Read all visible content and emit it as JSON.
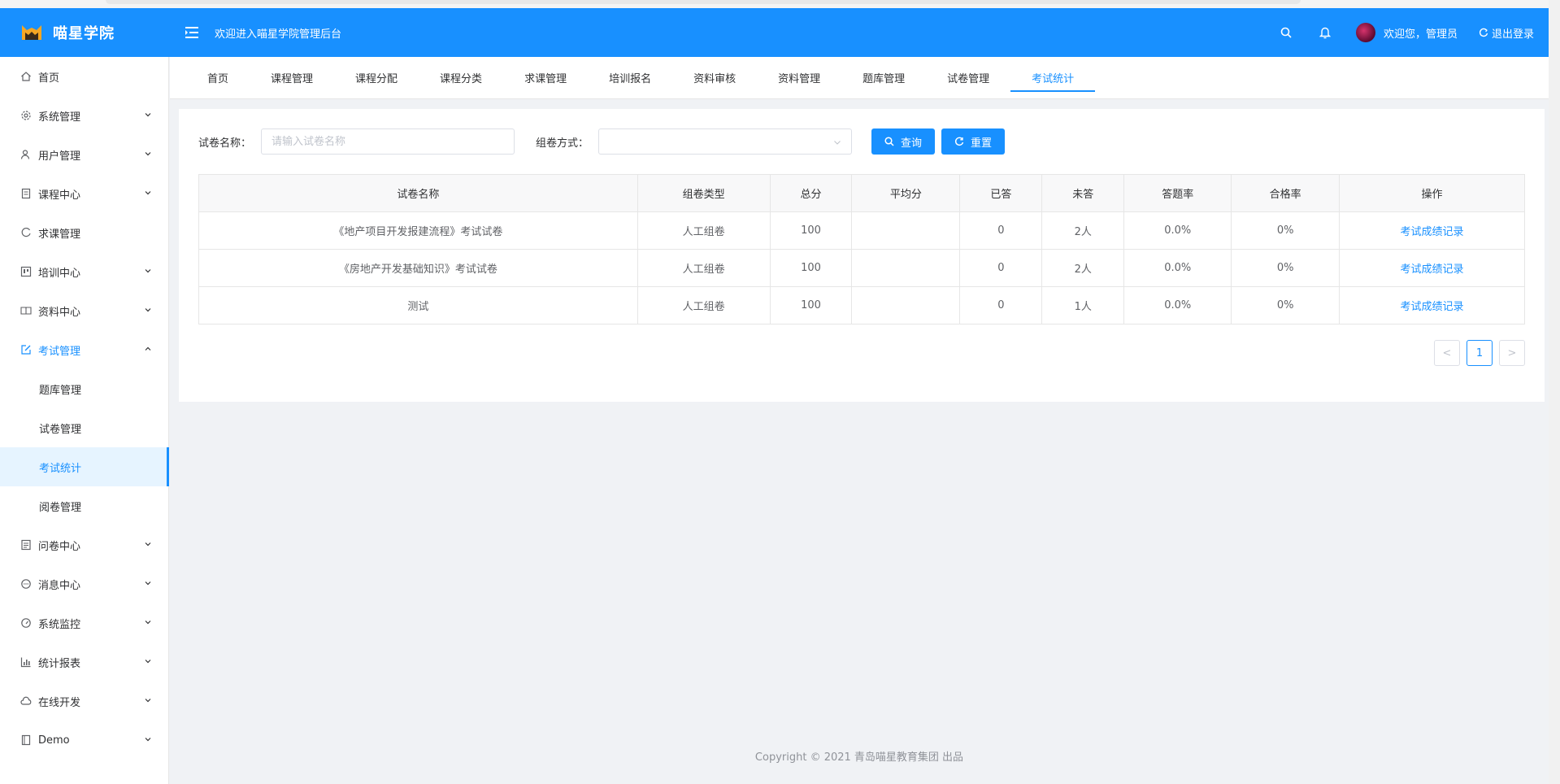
{
  "header": {
    "brand": "喵星学院",
    "welcome": "欢迎进入喵星学院管理后台",
    "greeting": "欢迎您，管理员",
    "logout": "退出登录"
  },
  "sidebar": {
    "items": [
      {
        "label": "首页",
        "icon": "home-icon"
      },
      {
        "label": "系统管理",
        "icon": "gear-icon"
      },
      {
        "label": "用户管理",
        "icon": "user-icon"
      },
      {
        "label": "课程中心",
        "icon": "document-icon"
      },
      {
        "label": "求课管理",
        "icon": "refresh-icon"
      },
      {
        "label": "培训中心",
        "icon": "board-icon"
      },
      {
        "label": "资料中心",
        "icon": "book-icon"
      },
      {
        "label": "考试管理",
        "icon": "edit-icon"
      },
      {
        "label": "问卷中心",
        "icon": "list-icon"
      },
      {
        "label": "消息中心",
        "icon": "chat-icon"
      },
      {
        "label": "系统监控",
        "icon": "gauge-icon"
      },
      {
        "label": "统计报表",
        "icon": "bar-chart-icon"
      },
      {
        "label": "在线开发",
        "icon": "cloud-icon"
      },
      {
        "label": "Demo",
        "icon": "file-icon"
      }
    ],
    "exam_sub": [
      "题库管理",
      "试卷管理",
      "考试统计",
      "阅卷管理"
    ]
  },
  "tabs": [
    "首页",
    "课程管理",
    "课程分配",
    "课程分类",
    "求课管理",
    "培训报名",
    "资料审核",
    "资料管理",
    "题库管理",
    "试卷管理",
    "考试统计"
  ],
  "filters": {
    "name_label": "试卷名称：",
    "name_placeholder": "请输入试卷名称",
    "mode_label": "组卷方式：",
    "query_label": "查询",
    "reset_label": "重置"
  },
  "table": {
    "headers": [
      "试卷名称",
      "组卷类型",
      "总分",
      "平均分",
      "已答",
      "未答",
      "答题率",
      "合格率",
      "操作"
    ],
    "rows": [
      [
        "《地产项目开发报建流程》考试试卷",
        "人工组卷",
        "100",
        "",
        "0",
        "2人",
        "0.0%",
        "0%",
        "考试成绩记录"
      ],
      [
        "《房地产开发基础知识》考试试卷",
        "人工组卷",
        "100",
        "",
        "0",
        "2人",
        "0.0%",
        "0%",
        "考试成绩记录"
      ],
      [
        "测试",
        "人工组卷",
        "100",
        "",
        "0",
        "1人",
        "0.0%",
        "0%",
        "考试成绩记录"
      ]
    ]
  },
  "pagination": {
    "current": "1",
    "prev": "<",
    "next": ">"
  },
  "footer": "Copyright © 2021 青岛喵星教育集团 出品",
  "colors": {
    "primary": "#1890ff"
  }
}
